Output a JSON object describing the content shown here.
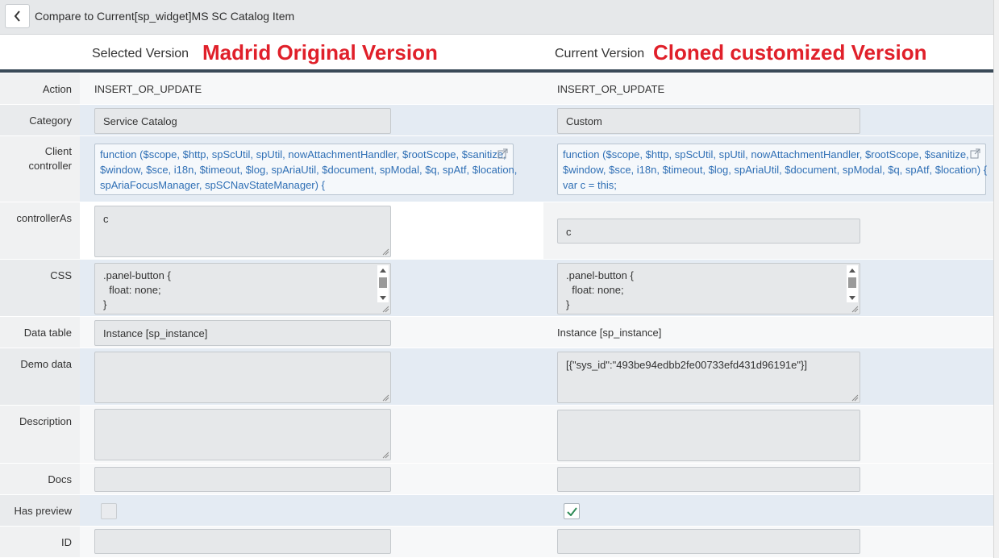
{
  "header": {
    "title": "Compare to Current[sp_widget]MS SC Catalog Item",
    "back_icon": "chevron-left-icon"
  },
  "versions": {
    "selected_label": "Selected Version",
    "selected_annotation": "Madrid Original Version",
    "current_label": "Current Version",
    "current_annotation": "Cloned customized Version"
  },
  "fields": {
    "action": {
      "label": "Action",
      "selected": "INSERT_OR_UPDATE",
      "current": "INSERT_OR_UPDATE"
    },
    "category": {
      "label": "Category",
      "selected": "Service Catalog",
      "current": "Custom"
    },
    "client_controller": {
      "label_line1": "Client",
      "label_line2": "controller",
      "selected_lines": [
        "function ($scope, $http, spScUtil, spUtil, nowAttachmentHandler, $rootScope, $sanitize,",
        "$window, $sce, i18n, $timeout, $log, spAriaUtil, $document, spModal, $q, spAtf, $location,",
        "spAriaFocusManager, spSCNavStateManager) {"
      ],
      "current_lines": [
        "function ($scope, $http, spScUtil, spUtil, nowAttachmentHandler, $rootScope, $sanitize,",
        "$window, $sce, i18n, $timeout, $log, spAriaUtil, $document, spModal, $q, spAtf, $location) {",
        "var c = this;"
      ]
    },
    "controller_as": {
      "label": "controllerAs",
      "selected": "c",
      "current": "c"
    },
    "css": {
      "label": "CSS",
      "selected_lines": [
        ".panel-button {",
        "  float: none;",
        "}"
      ],
      "current_lines": [
        ".panel-button {",
        "  float: none;",
        "}"
      ]
    },
    "data_table": {
      "label": "Data table",
      "selected": "Instance [sp_instance]",
      "current": "Instance [sp_instance]"
    },
    "demo_data": {
      "label": "Demo data",
      "selected": "",
      "current": "[{\"sys_id\":\"493be94edbb2fe00733efd431d96191e\"}]"
    },
    "description": {
      "label": "Description",
      "selected": "",
      "current": ""
    },
    "docs": {
      "label": "Docs",
      "selected": "",
      "current": ""
    },
    "has_preview": {
      "label": "Has preview",
      "selected_checked": false,
      "current_checked": true
    },
    "id": {
      "label": "ID",
      "selected": "",
      "current": ""
    }
  }
}
